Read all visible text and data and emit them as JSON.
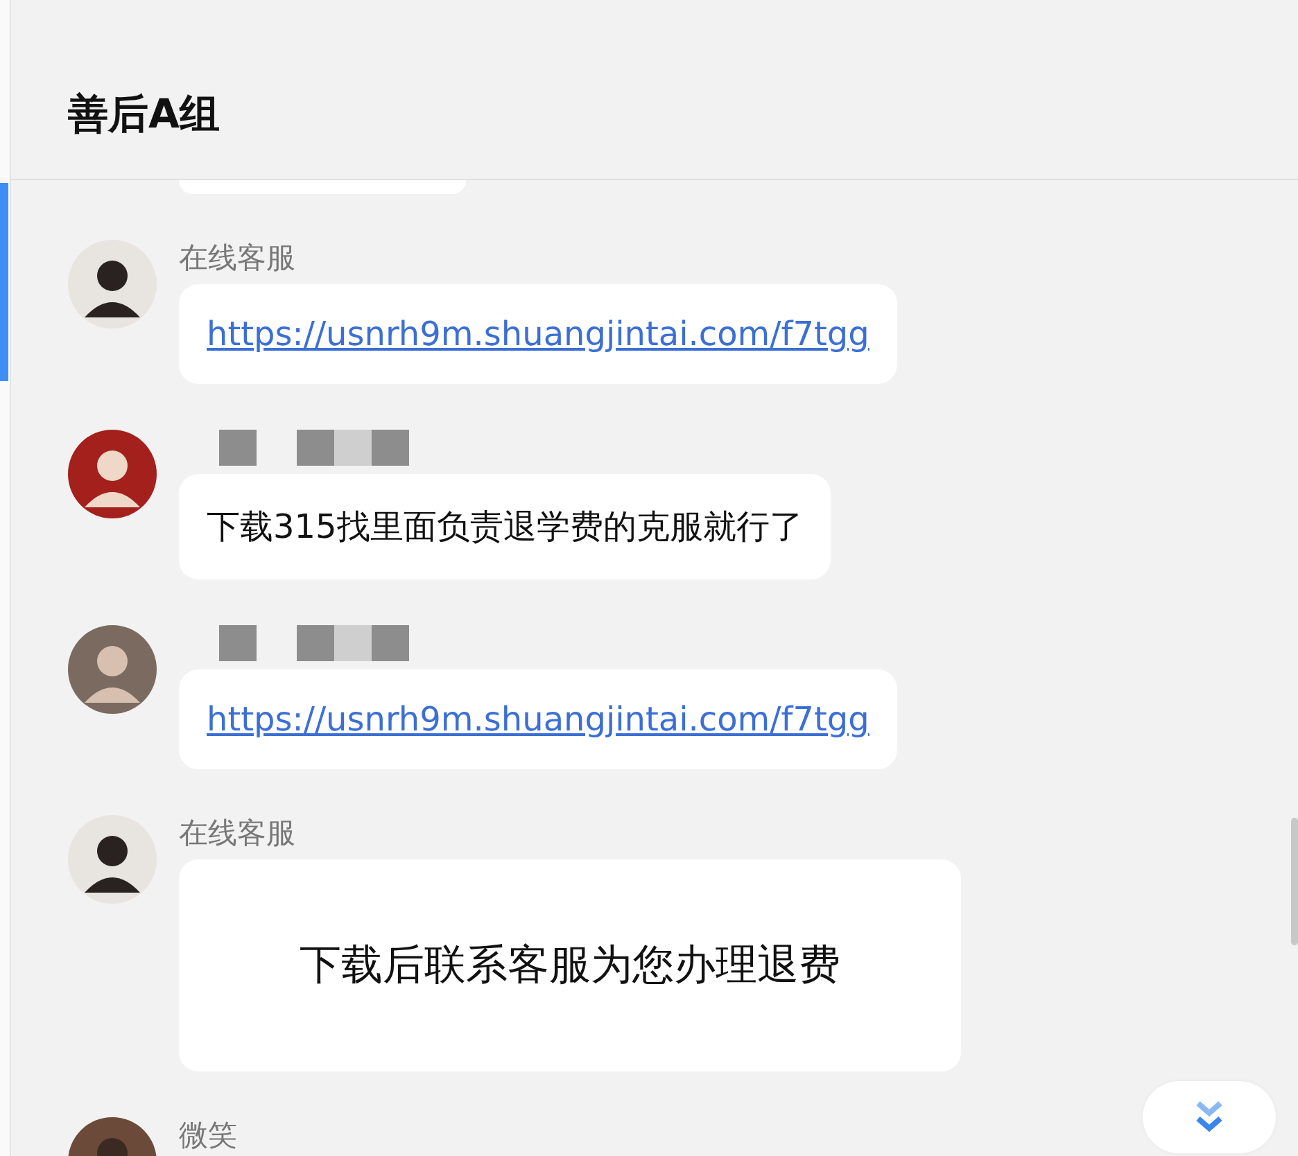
{
  "header": {
    "title": "善后A组"
  },
  "messages": [
    {
      "kind": "link",
      "name": "在线客服",
      "text": "https://usnrh9m.shuangjintai.com/f7tgg"
    },
    {
      "kind": "text",
      "name_redacted": true,
      "text": "下载315找里面负责退学费的克服就行了"
    },
    {
      "kind": "link",
      "name_redacted": true,
      "text": "https://usnrh9m.shuangjintai.com/f7tgg"
    },
    {
      "kind": "image",
      "name": "在线客服",
      "text": "下载后联系客服为您办理退费"
    },
    {
      "kind": "cut",
      "name": "微笑"
    }
  ]
}
